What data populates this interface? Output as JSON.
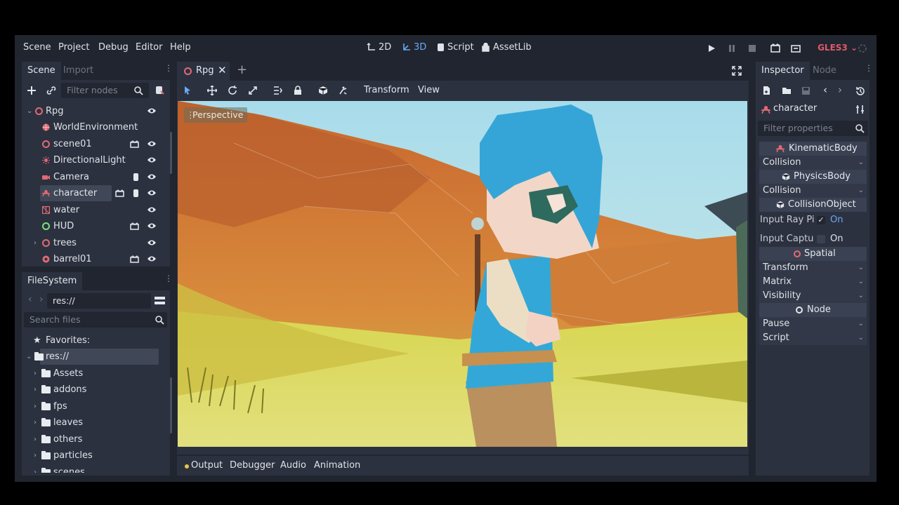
{
  "menu": {
    "items": [
      "Scene",
      "Project",
      "Debug",
      "Editor",
      "Help"
    ]
  },
  "modes": {
    "d2": "2D",
    "d3": "3D",
    "script": "Script",
    "assetlib": "AssetLib"
  },
  "renderer": "GLES3",
  "scene_panel": {
    "tabs": [
      "Scene",
      "Import"
    ],
    "filter_placeholder": "Filter nodes",
    "nodes": [
      {
        "label": "Rpg",
        "icon": "spatial-icon"
      },
      {
        "label": "WorldEnvironment",
        "icon": "world-environment-icon"
      },
      {
        "label": "scene01",
        "icon": "spatial-icon"
      },
      {
        "label": "DirectionalLight",
        "icon": "light-icon"
      },
      {
        "label": "Camera",
        "icon": "camera-icon"
      },
      {
        "label": "character",
        "icon": "kinematic-body-icon"
      },
      {
        "label": "water",
        "icon": "mesh-icon"
      },
      {
        "label": "HUD",
        "icon": "control-icon"
      },
      {
        "label": "trees",
        "icon": "spatial-icon"
      },
      {
        "label": "barrel01",
        "icon": "rigid-body-icon"
      }
    ]
  },
  "filesystem": {
    "tab": "FileSystem",
    "path": "res://",
    "search_placeholder": "Search files",
    "favorites": "Favorites:",
    "root": "res://",
    "folders": [
      "Assets",
      "addons",
      "fps",
      "leaves",
      "others",
      "particles",
      "scenes"
    ]
  },
  "viewport": {
    "tab": "Rpg",
    "menu_transform": "Transform",
    "menu_view": "View",
    "perspective": "Perspective"
  },
  "bottom_tabs": [
    "Output",
    "Debugger",
    "Audio",
    "Animation"
  ],
  "inspector": {
    "tabs": [
      "Inspector",
      "Node"
    ],
    "object": "character",
    "filter_placeholder": "Filter properties",
    "kinematic_body": "KinematicBody",
    "collision_1": "Collision",
    "physics_body": "PhysicsBody",
    "collision_2": "Collision",
    "collision_object": "CollisionObject",
    "input_ray_label": "Input Ray Pi",
    "input_ray_value": "On",
    "input_capture_label": "Input Captu",
    "input_capture_value": "On",
    "spatial": "Spatial",
    "transform": "Transform",
    "matrix": "Matrix",
    "visibility": "Visibility",
    "node": "Node",
    "pause": "Pause",
    "script": "Script"
  },
  "colors": {
    "accent": "#6aa9f4",
    "panel": "#2c3140",
    "background": "#21252f",
    "renderer": "#e05a6a"
  }
}
